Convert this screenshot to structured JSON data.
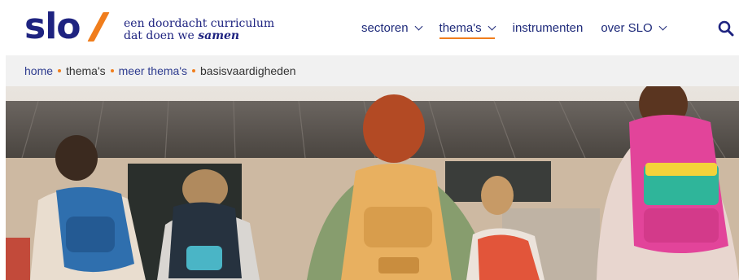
{
  "header": {
    "logo_text": "slo",
    "tagline_line1": "een doordacht curriculum",
    "tagline_line2_prefix": "dat doen we ",
    "tagline_line2_emphasis": "samen",
    "brand_colors": {
      "primary": "#1e2380",
      "accent": "#f07d1c"
    }
  },
  "nav": {
    "items": [
      {
        "label": "sectoren",
        "has_dropdown": true,
        "active": false
      },
      {
        "label": "thema's",
        "has_dropdown": true,
        "active": true
      },
      {
        "label": "instrumenten",
        "has_dropdown": false,
        "active": false
      },
      {
        "label": "over SLO",
        "has_dropdown": true,
        "active": false
      }
    ],
    "search_icon": "search-icon"
  },
  "breadcrumb": {
    "items": [
      {
        "label": "home",
        "link": true
      },
      {
        "label": "thema's",
        "link": false
      },
      {
        "label": "meer thema's",
        "link": true
      },
      {
        "label": "basisvaardigheden",
        "link": false
      }
    ]
  },
  "hero": {
    "image_subject": "children with backpacks walking to school entrance"
  }
}
